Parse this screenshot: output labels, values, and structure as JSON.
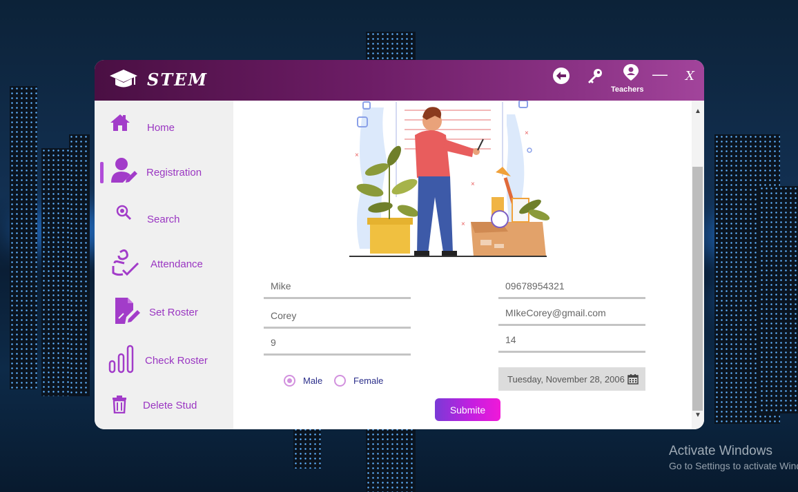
{
  "app": {
    "logo_text": "STEM",
    "user_label": "Teachers",
    "minimize_symbol": "—",
    "close_symbol": "X",
    "icons": [
      "back-arrow-icon",
      "key-icon",
      "user-pin-icon"
    ]
  },
  "sidebar": {
    "items": [
      {
        "label": "Home",
        "icon": "home-icon"
      },
      {
        "label": "Registration",
        "icon": "user-edit-icon"
      },
      {
        "label": "Search",
        "icon": "search-icon"
      },
      {
        "label": "Attendance",
        "icon": "attendance-icon"
      },
      {
        "label": "Set Roster",
        "icon": "document-edit-icon"
      },
      {
        "label": "Check Roster",
        "icon": "bar-chart-icon"
      },
      {
        "label": "Delete Stud",
        "icon": "trash-icon"
      }
    ],
    "active": "Registration"
  },
  "form": {
    "first_name": "Mike",
    "last_name": "Corey",
    "grade": "9",
    "phone": "09678954321",
    "email": "MIkeCorey@gmail.com",
    "age": "14",
    "gender_options": [
      "Male",
      "Female"
    ],
    "gender_selected": "Male",
    "birth_date": "Tuesday, November 28, 2006",
    "submit_label": "Submite"
  },
  "scrollbar": {
    "up": "▲",
    "down": "▼"
  },
  "os_watermark": {
    "title": "Activate Windows",
    "subtitle": "Go to Settings to activate Windows."
  },
  "colors": {
    "titlebar_start": "#4a0f43",
    "titlebar_end": "#a2449b",
    "accent_purple": "#9a36c2",
    "submit_start": "#7a3ad6",
    "submit_end": "#f019d8"
  }
}
